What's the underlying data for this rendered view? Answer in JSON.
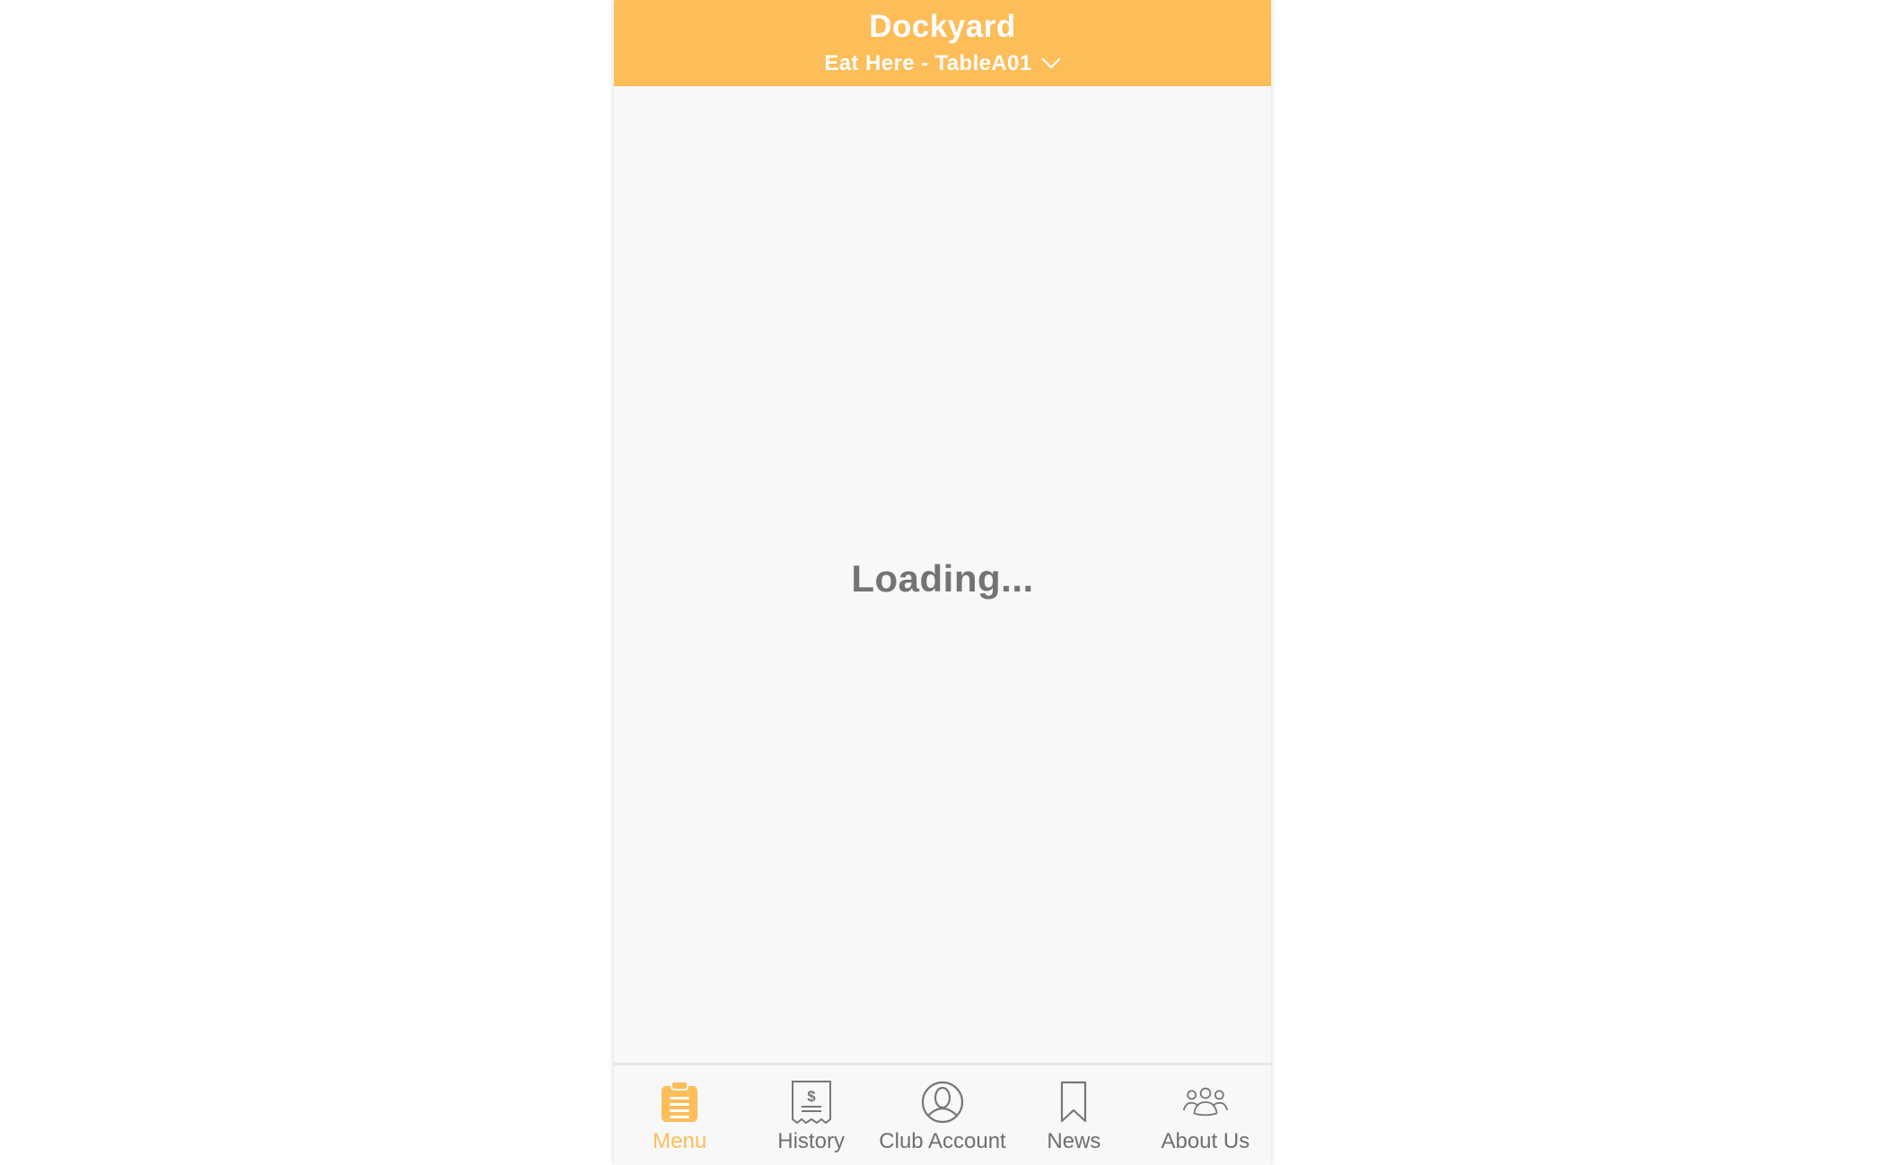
{
  "colors": {
    "accent": "#fdbd58",
    "header_text": "#ffffff",
    "loading_text": "#737373",
    "tab_inactive": "#6f6f6f",
    "background": "#f8f8f8"
  },
  "header": {
    "title": "Dockyard",
    "subtitle": "Eat Here - TableA01",
    "subtitle_icon": "chevron-down-icon"
  },
  "content": {
    "loading_text": "Loading..."
  },
  "tabbar": {
    "active_tab": "Menu",
    "tabs": [
      {
        "label": "Menu",
        "icon": "clipboard-icon"
      },
      {
        "label": "History",
        "icon": "receipt-icon"
      },
      {
        "label": "Club Account",
        "icon": "user-circle-icon"
      },
      {
        "label": "News",
        "icon": "bookmark-icon"
      },
      {
        "label": "About Us",
        "icon": "group-icon"
      }
    ]
  }
}
